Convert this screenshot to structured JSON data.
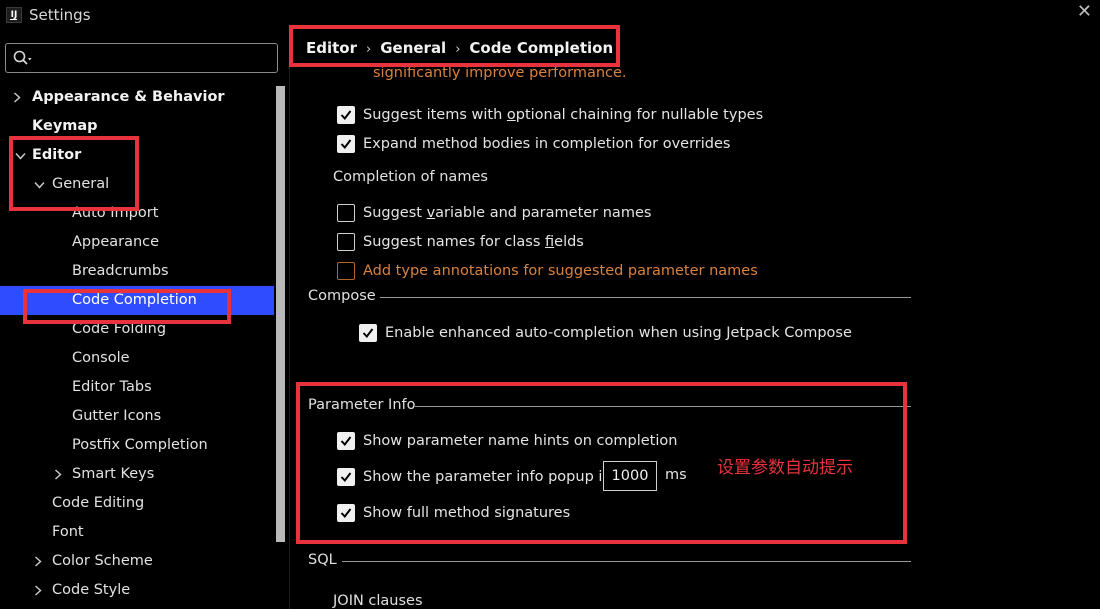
{
  "window": {
    "logo_text": "IJ",
    "title": "Settings"
  },
  "search": {
    "placeholder": "",
    "value": ""
  },
  "sidebar": {
    "items": [
      {
        "label": "Appearance & Behavior",
        "arrow": "right"
      },
      {
        "label": "Keymap"
      },
      {
        "label": "Editor",
        "arrow": "down"
      },
      {
        "label": "General",
        "arrow": "down"
      },
      {
        "label": "Auto Import"
      },
      {
        "label": "Appearance"
      },
      {
        "label": "Breadcrumbs"
      },
      {
        "label": "Code Completion",
        "selected": true
      },
      {
        "label": "Code Folding"
      },
      {
        "label": "Console"
      },
      {
        "label": "Editor Tabs"
      },
      {
        "label": "Gutter Icons"
      },
      {
        "label": "Postfix Completion"
      },
      {
        "label": "Smart Keys",
        "arrow": "right"
      },
      {
        "label": "Code Editing"
      },
      {
        "label": "Font"
      },
      {
        "label": "Color Scheme",
        "arrow": "right"
      },
      {
        "label": "Code Style",
        "arrow": "right"
      }
    ]
  },
  "breadcrumb": {
    "items": [
      "Editor",
      "General",
      "Code Completion"
    ],
    "separator": "›"
  },
  "main": {
    "warning_text": "significantly improve performance.",
    "optional_chaining": {
      "pre": "Suggest items with ",
      "ul": "o",
      "post": "ptional chaining for nullable types",
      "checked": true
    },
    "expand_bodies": {
      "label": "Expand method bodies in completion for overrides",
      "checked": true
    },
    "names_section": "Completion of names",
    "suggest_variable": {
      "pre": "Suggest ",
      "ul": "v",
      "post": "ariable and parameter names",
      "checked": false
    },
    "suggest_fields": {
      "pre": "Suggest names for class ",
      "ul": "f",
      "post": "ields",
      "checked": false
    },
    "type_annotations": {
      "label": "Add type annotations for suggested parameter names",
      "checked": false
    },
    "compose_section": "Compose",
    "compose_enhanced": {
      "label": "Enable enhanced auto-completion when using Jetpack Compose",
      "checked": true
    },
    "param_section": "Parameter Info",
    "param_hints": {
      "label": "Show parameter name hints on completion",
      "checked": true
    },
    "param_popup": {
      "label": "Show the parameter info popup in",
      "value": "1000",
      "unit": "ms",
      "checked": true
    },
    "full_signatures": {
      "label": "Show full method signatures",
      "checked": true
    },
    "sql_section": "SQL",
    "join_clauses": "JOIN clauses"
  },
  "annotation": {
    "note": "设置参数自动提示",
    "color": "#e8323c"
  },
  "colors": {
    "selection": "#2f4dff",
    "warning": "#d9823f",
    "annotation": "#e8323c"
  }
}
